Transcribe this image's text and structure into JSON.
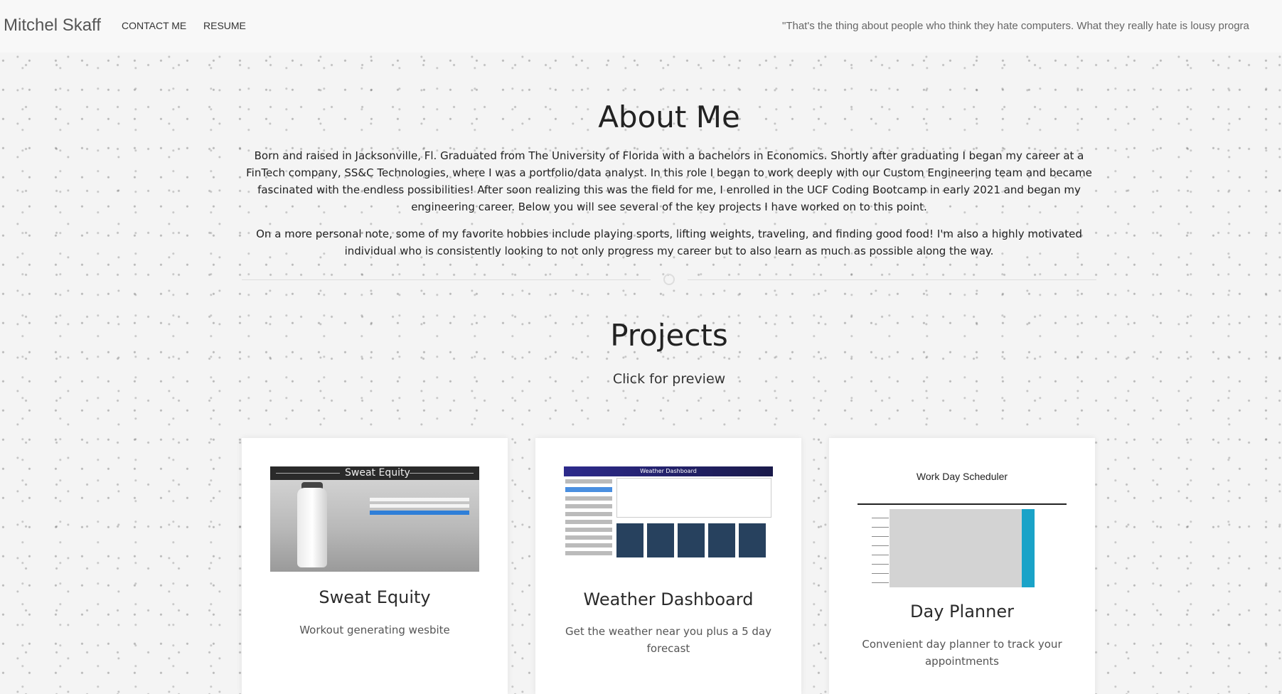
{
  "navbar": {
    "brand": "Mitchel Skaff",
    "links": [
      {
        "label": "CONTACT ME"
      },
      {
        "label": "RESUME"
      }
    ],
    "quote": "\"That's the thing about people who think they hate computers. What they really hate is lousy progra"
  },
  "about": {
    "title": "About Me",
    "paragraphs": [
      "Born and raised in Jacksonville, Fl. Graduated from The University of Florida with a bachelors in Economics. Shortly after graduating I began my career at a FinTech company, SS&C Technologies, where I was a portfolio/data analyst. In this role I began to work deeply with our Custom Engineering team and became fascinated with the endless possibilities! After soon realizing this was the field for me, I enrolled in the UCF Coding Bootcamp in early 2021 and began my engineering career. Below you will see several of the key projects I have worked on to this point.",
      "On a more personal note, some of my favorite hobbies include playing sports, lifting weights, traveling, and finding good food! I'm also a highly motivated individual who is consistently looking to not only progress my career but to also learn as much as possible along the way."
    ]
  },
  "projects": {
    "title": "Projects",
    "subtitle": "Click for preview",
    "cards": [
      {
        "title": "Sweat Equity",
        "description": "Workout generating wesbite",
        "thumbnail_text": "Sweat Equity"
      },
      {
        "title": "Weather Dashboard",
        "description": "Get the weather near you plus a 5 day forecast",
        "thumbnail_text": "Weather Dashboard"
      },
      {
        "title": "Day Planner",
        "description": "Convenient day planner to track your appointments",
        "thumbnail_text": "Work Day Scheduler"
      }
    ]
  }
}
